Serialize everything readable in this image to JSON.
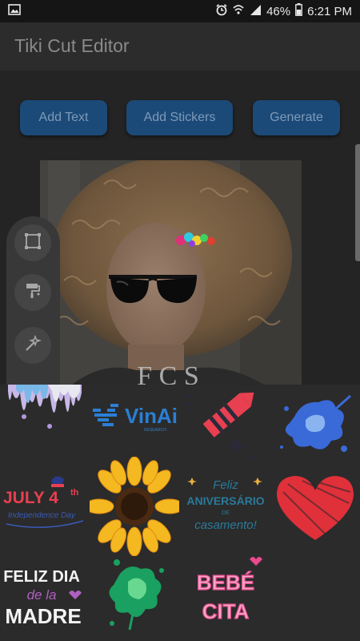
{
  "status_bar": {
    "battery": "46%",
    "time": "6:21 PM",
    "icons": [
      "image-icon",
      "alarm-icon",
      "wifi-icon",
      "signal-icon",
      "battery-icon"
    ]
  },
  "app": {
    "title": "Tiki Cut Editor"
  },
  "toolbar": {
    "add_text_label": "Add Text",
    "add_stickers_label": "Add Stickers",
    "generate_label": "Generate"
  },
  "photo": {
    "caption": "F C S",
    "overlays": [
      "sunglasses-sticker",
      "flower-hair-sticker"
    ]
  },
  "tools": [
    {
      "icon": "crop-frame-icon"
    },
    {
      "icon": "paint-roller-icon"
    },
    {
      "icon": "magic-wand-icon"
    }
  ],
  "stickers": [
    {
      "name": "paint-drip-sticker"
    },
    {
      "name": "vinai-logo-sticker",
      "text": "VinAi",
      "subtext": "RESEARCH"
    },
    {
      "name": "firework-rocket-sticker"
    },
    {
      "name": "blue-splash-sticker"
    },
    {
      "name": "july-4th-sticker",
      "line1": "JULY 4",
      "sup": "th",
      "line2": "Independence Day"
    },
    {
      "name": "sunflower-sticker"
    },
    {
      "name": "feliz-aniversario-sticker",
      "line1": "Feliz",
      "line2": "ANIVERSÁRIO",
      "line3": "DE",
      "line4": "casamento!"
    },
    {
      "name": "red-heart-sticker"
    },
    {
      "name": "feliz-dia-madre-sticker",
      "line1": "FELIZ DIA",
      "line2": "de la",
      "line3": "MADRE"
    },
    {
      "name": "green-splash-sticker"
    },
    {
      "name": "bebecita-sticker",
      "line1": "BEBÉ",
      "line2": "CITA"
    }
  ],
  "colors": {
    "button_bg": "#1c4a78",
    "button_text": "#7d9ab8",
    "panel_bg": "#2b2b2b",
    "accent_red": "#e0303a"
  }
}
